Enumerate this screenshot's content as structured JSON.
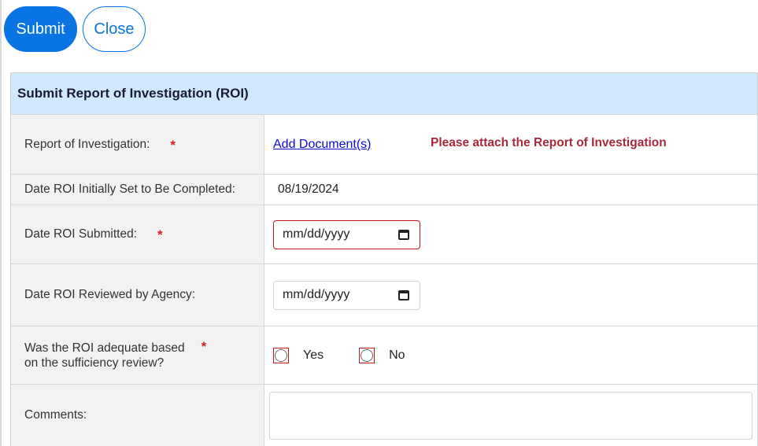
{
  "actions": {
    "submit_label": "Submit",
    "close_label": "Close"
  },
  "form": {
    "title": "Submit Report of Investigation (ROI)",
    "required_mark": "*",
    "report": {
      "label": "Report of Investigation:",
      "link": "Add Document(s)",
      "error": "Please attach the Report of Investigation"
    },
    "initial_date": {
      "label": "Date ROI Initially Set to Be Completed:",
      "value": "08/19/2024"
    },
    "submitted_date": {
      "label": "Date ROI Submitted:",
      "placeholder": "mm/dd/yyyy"
    },
    "reviewed_date": {
      "label": "Date ROI Reviewed by Agency:",
      "placeholder": "mm/dd/yyyy"
    },
    "adequacy": {
      "label_line1": "Was the ROI adequate based",
      "label_line2": "on the sufficiency review?",
      "options": [
        "Yes",
        "No"
      ]
    },
    "comments": {
      "label": "Comments:",
      "value": ""
    }
  },
  "colors": {
    "primary": "#0b74e5",
    "header_bg": "#cfe9fb",
    "error": "#a52a3a",
    "required": "#d21f1f"
  }
}
